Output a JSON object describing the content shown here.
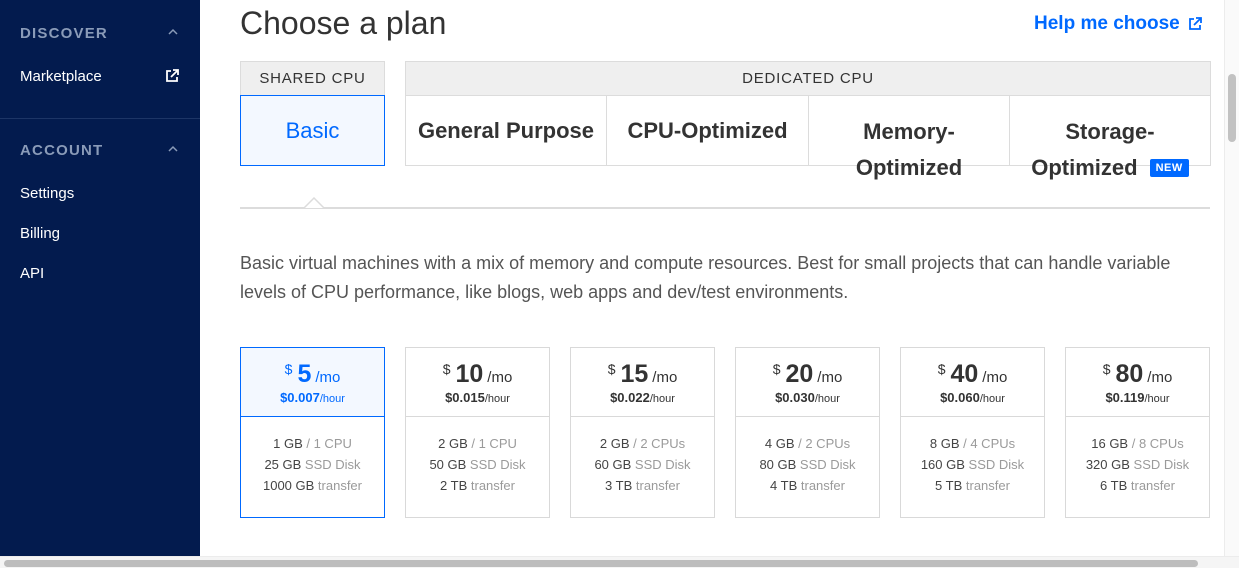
{
  "sidebar": {
    "discover_heading": "DISCOVER",
    "discover_items": [
      {
        "label": "Marketplace",
        "icon": "external-link-icon"
      }
    ],
    "account_heading": "ACCOUNT",
    "account_items": [
      {
        "label": "Settings"
      },
      {
        "label": "Billing"
      },
      {
        "label": "API"
      }
    ]
  },
  "main": {
    "title": "Choose a plan",
    "help_link": "Help me choose",
    "shared_cpu_heading": "SHARED CPU",
    "dedicated_cpu_heading": "DEDICATED CPU",
    "tabs": [
      {
        "label": "Basic",
        "active": true
      },
      {
        "label": "General Purpose"
      },
      {
        "label": "CPU-Optimized"
      },
      {
        "label_line1": "Memory-",
        "label_line2": "Optimized"
      },
      {
        "label_line1": "Storage-",
        "label_line2": "Optimized",
        "badge": "NEW"
      }
    ],
    "description": "Basic virtual machines with a mix of memory and compute resources. Best for small projects that can handle variable levels of CPU performance, like blogs, web apps and dev/test environments."
  },
  "plans": [
    {
      "currency": "$",
      "amount": "5",
      "per": "/mo",
      "hourly": "$0.007",
      "hourly_unit": "/hour",
      "mem": "1 GB",
      "cpu": " / 1 CPU",
      "disk": "25 GB",
      "disk_label": " SSD Disk",
      "transfer": "1000 GB",
      "transfer_label": " transfer",
      "selected": true
    },
    {
      "currency": "$",
      "amount": "10",
      "per": "/mo",
      "hourly": "$0.015",
      "hourly_unit": "/hour",
      "mem": "2 GB",
      "cpu": " / 1 CPU",
      "disk": "50 GB",
      "disk_label": " SSD Disk",
      "transfer": "2 TB",
      "transfer_label": " transfer"
    },
    {
      "currency": "$",
      "amount": "15",
      "per": "/mo",
      "hourly": "$0.022",
      "hourly_unit": "/hour",
      "mem": "2 GB",
      "cpu": " / 2 CPUs",
      "disk": "60 GB",
      "disk_label": " SSD Disk",
      "transfer": "3 TB",
      "transfer_label": " transfer"
    },
    {
      "currency": "$",
      "amount": "20",
      "per": "/mo",
      "hourly": "$0.030",
      "hourly_unit": "/hour",
      "mem": "4 GB",
      "cpu": " / 2 CPUs",
      "disk": "80 GB",
      "disk_label": " SSD Disk",
      "transfer": "4 TB",
      "transfer_label": " transfer"
    },
    {
      "currency": "$",
      "amount": "40",
      "per": "/mo",
      "hourly": "$0.060",
      "hourly_unit": "/hour",
      "mem": "8 GB",
      "cpu": " / 4 CPUs",
      "disk": "160 GB",
      "disk_label": " SSD Disk",
      "transfer": "5 TB",
      "transfer_label": " transfer"
    },
    {
      "currency": "$",
      "amount": "80",
      "per": "/mo",
      "hourly": "$0.119",
      "hourly_unit": "/hour",
      "mem": "16 GB",
      "cpu": " / 8 CPUs",
      "disk": "320 GB",
      "disk_label": " SSD Disk",
      "transfer": "6 TB",
      "transfer_label": " transfer"
    }
  ],
  "colors": {
    "sidebar_bg": "#031b4e",
    "accent": "#0069ff"
  }
}
